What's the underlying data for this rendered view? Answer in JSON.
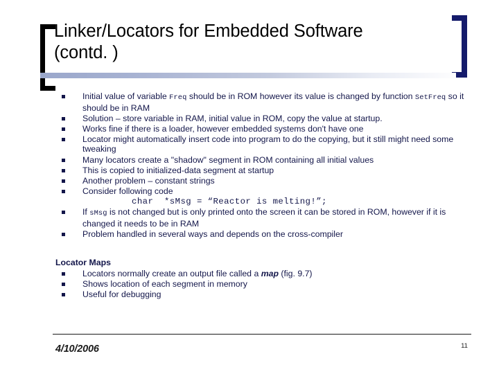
{
  "slide": {
    "title": "Linker/Locators for Embedded Software\n(contd. )",
    "accent_navy": "#13164a",
    "bracket_left_color": "#000000",
    "bracket_right_color": "#151B6B",
    "rule_gradient_start": "#9aa7cb",
    "rule_gradient_end": "#ffffff"
  },
  "bullets": [
    {
      "id": "bullet-initial-value",
      "parts": [
        {
          "text": "Initial value of variable ",
          "style": "normal"
        },
        {
          "text": "Freq",
          "style": "mono"
        },
        {
          "text": " should be in ROM however its value is changed by function ",
          "style": "normal"
        },
        {
          "text": "SetFreq",
          "style": "mono"
        },
        {
          "text": " so it should be in RAM",
          "style": "normal"
        }
      ]
    },
    {
      "id": "bullet-solution",
      "parts": [
        {
          "text": "Solution – store variable in RAM, initial value in ROM, copy the value at startup.",
          "style": "normal"
        }
      ]
    },
    {
      "id": "bullet-loader",
      "parts": [
        {
          "text": "Works fine if there is a loader, however embedded systems don't have one",
          "style": "normal"
        }
      ]
    },
    {
      "id": "bullet-locator-insert-code",
      "parts": [
        {
          "text": "Locator might automatically insert code into program to do the copying, but it still might need some tweaking",
          "style": "normal"
        }
      ]
    },
    {
      "id": "bullet-shadow-segment",
      "parts": [
        {
          "text": "Many locators create a \"shadow\" segment in ROM containing all initial values",
          "style": "normal"
        }
      ]
    },
    {
      "id": "bullet-copied-initialized-data",
      "parts": [
        {
          "text": "This is copied to initialized-data segment at startup",
          "style": "normal"
        }
      ]
    },
    {
      "id": "bullet-constant-strings",
      "parts": [
        {
          "text": "Another problem – constant strings",
          "style": "normal"
        }
      ]
    },
    {
      "id": "bullet-consider-code",
      "parts": [
        {
          "text": "Consider following code",
          "style": "normal"
        }
      ]
    }
  ],
  "code_line": "char  *sMsg = “Reactor is melting!”;",
  "bullets_after_code": [
    {
      "id": "bullet-smsg-rom",
      "parts": [
        {
          "text": "If ",
          "style": "normal"
        },
        {
          "text": "sMsg",
          "style": "mono"
        },
        {
          "text": " is not changed but is only printed onto the screen it can be stored in ROM, however if it is changed it needs to be in RAM",
          "style": "normal"
        }
      ]
    },
    {
      "id": "bullet-cross-compiler",
      "parts": [
        {
          "text": "Problem handled in several ways and depends on the cross-compiler",
          "style": "normal"
        }
      ]
    }
  ],
  "locator_section": {
    "heading": "Locator Maps",
    "bullets": [
      {
        "id": "bullet-output-file-map",
        "parts": [
          {
            "text": "Locators normally create an output file called a ",
            "style": "normal"
          },
          {
            "text": "map",
            "style": "bold-italic"
          },
          {
            "text": " (fig. 9.7)",
            "style": "normal"
          }
        ]
      },
      {
        "id": "bullet-shows-location",
        "parts": [
          {
            "text": "Shows location of each segment in memory",
            "style": "normal"
          }
        ]
      },
      {
        "id": "bullet-useful-debugging",
        "parts": [
          {
            "text": "Useful for debugging",
            "style": "normal"
          }
        ]
      }
    ]
  },
  "footer": {
    "date": "4/10/2006",
    "page_number": "11"
  }
}
